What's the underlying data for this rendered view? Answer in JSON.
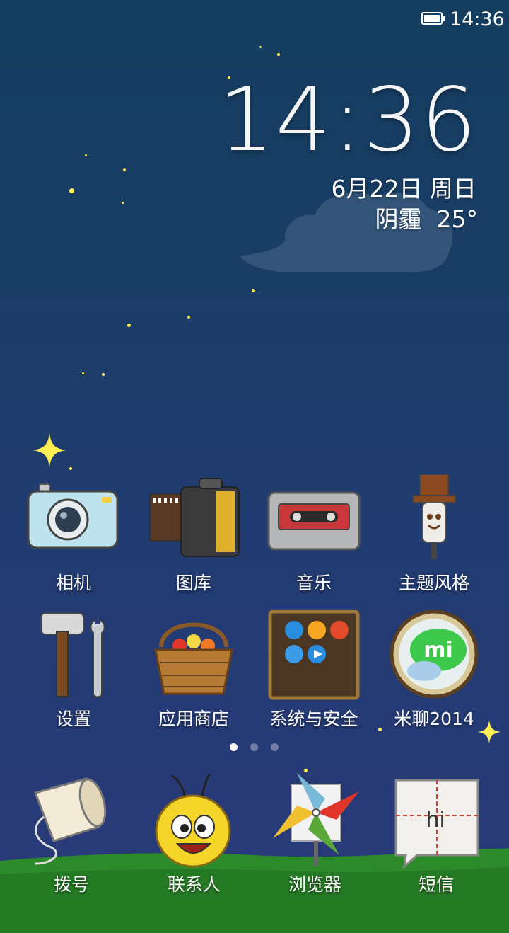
{
  "status_bar": {
    "time": "14:36"
  },
  "clock_widget": {
    "time": "14:36",
    "date": "6月22日 周日",
    "weather": "阴霾  25°"
  },
  "apps": [
    {
      "label": "相机",
      "icon": "camera-icon"
    },
    {
      "label": "图库",
      "icon": "film-roll-icon"
    },
    {
      "label": "音乐",
      "icon": "cassette-icon"
    },
    {
      "label": "主题风格",
      "icon": "scarecrow-icon"
    },
    {
      "label": "设置",
      "icon": "hammer-wrench-icon"
    },
    {
      "label": "应用商店",
      "icon": "basket-icon"
    },
    {
      "label": "系统与安全",
      "icon": "folder-board-icon"
    },
    {
      "label": "米聊2014",
      "icon": "mi-chat-icon"
    }
  ],
  "folder_icon_glyph": "hi",
  "mi_glyph": "mi",
  "pages": {
    "count": 3,
    "active_index": 0
  },
  "dock": [
    {
      "label": "拨号",
      "icon": "paper-cup-phone-icon"
    },
    {
      "label": "联系人",
      "icon": "bee-icon"
    },
    {
      "label": "浏览器",
      "icon": "pinwheel-icon"
    },
    {
      "label": "短信",
      "icon": "message-card-icon"
    }
  ],
  "colors": {
    "star": "#ffee55",
    "grass": "#2d8a2a",
    "sky_top": "#143d5f",
    "sky_bottom": "#2a3a7a"
  }
}
